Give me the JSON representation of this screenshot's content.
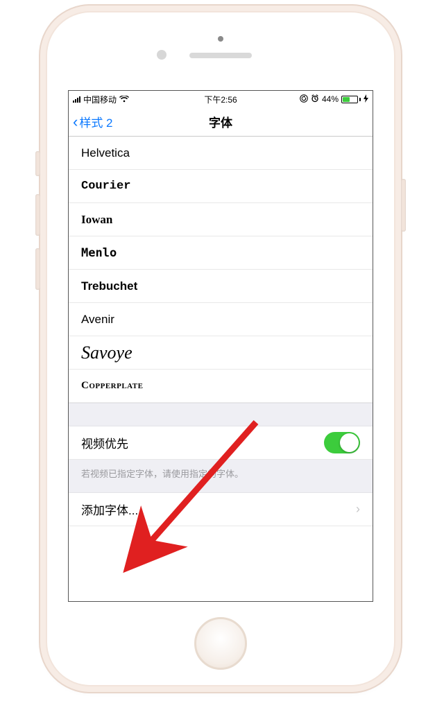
{
  "statusbar": {
    "carrier": "中国移动",
    "time": "下午2:56",
    "battery_pct": "44%"
  },
  "nav": {
    "back_label": "样式 2",
    "title": "字体"
  },
  "fonts": {
    "helvetica": "Helvetica",
    "courier": "Courier",
    "iowan": "Iowan",
    "menlo": "Menlo",
    "trebuchet": "Trebuchet",
    "avenir": "Avenir",
    "savoye": "Savoye",
    "copperplate": "Copperplate"
  },
  "video_pref": {
    "label": "视频优先",
    "footer": "若视频已指定字体，请使用指定的字体。"
  },
  "add_font": {
    "label": "添加字体..."
  }
}
